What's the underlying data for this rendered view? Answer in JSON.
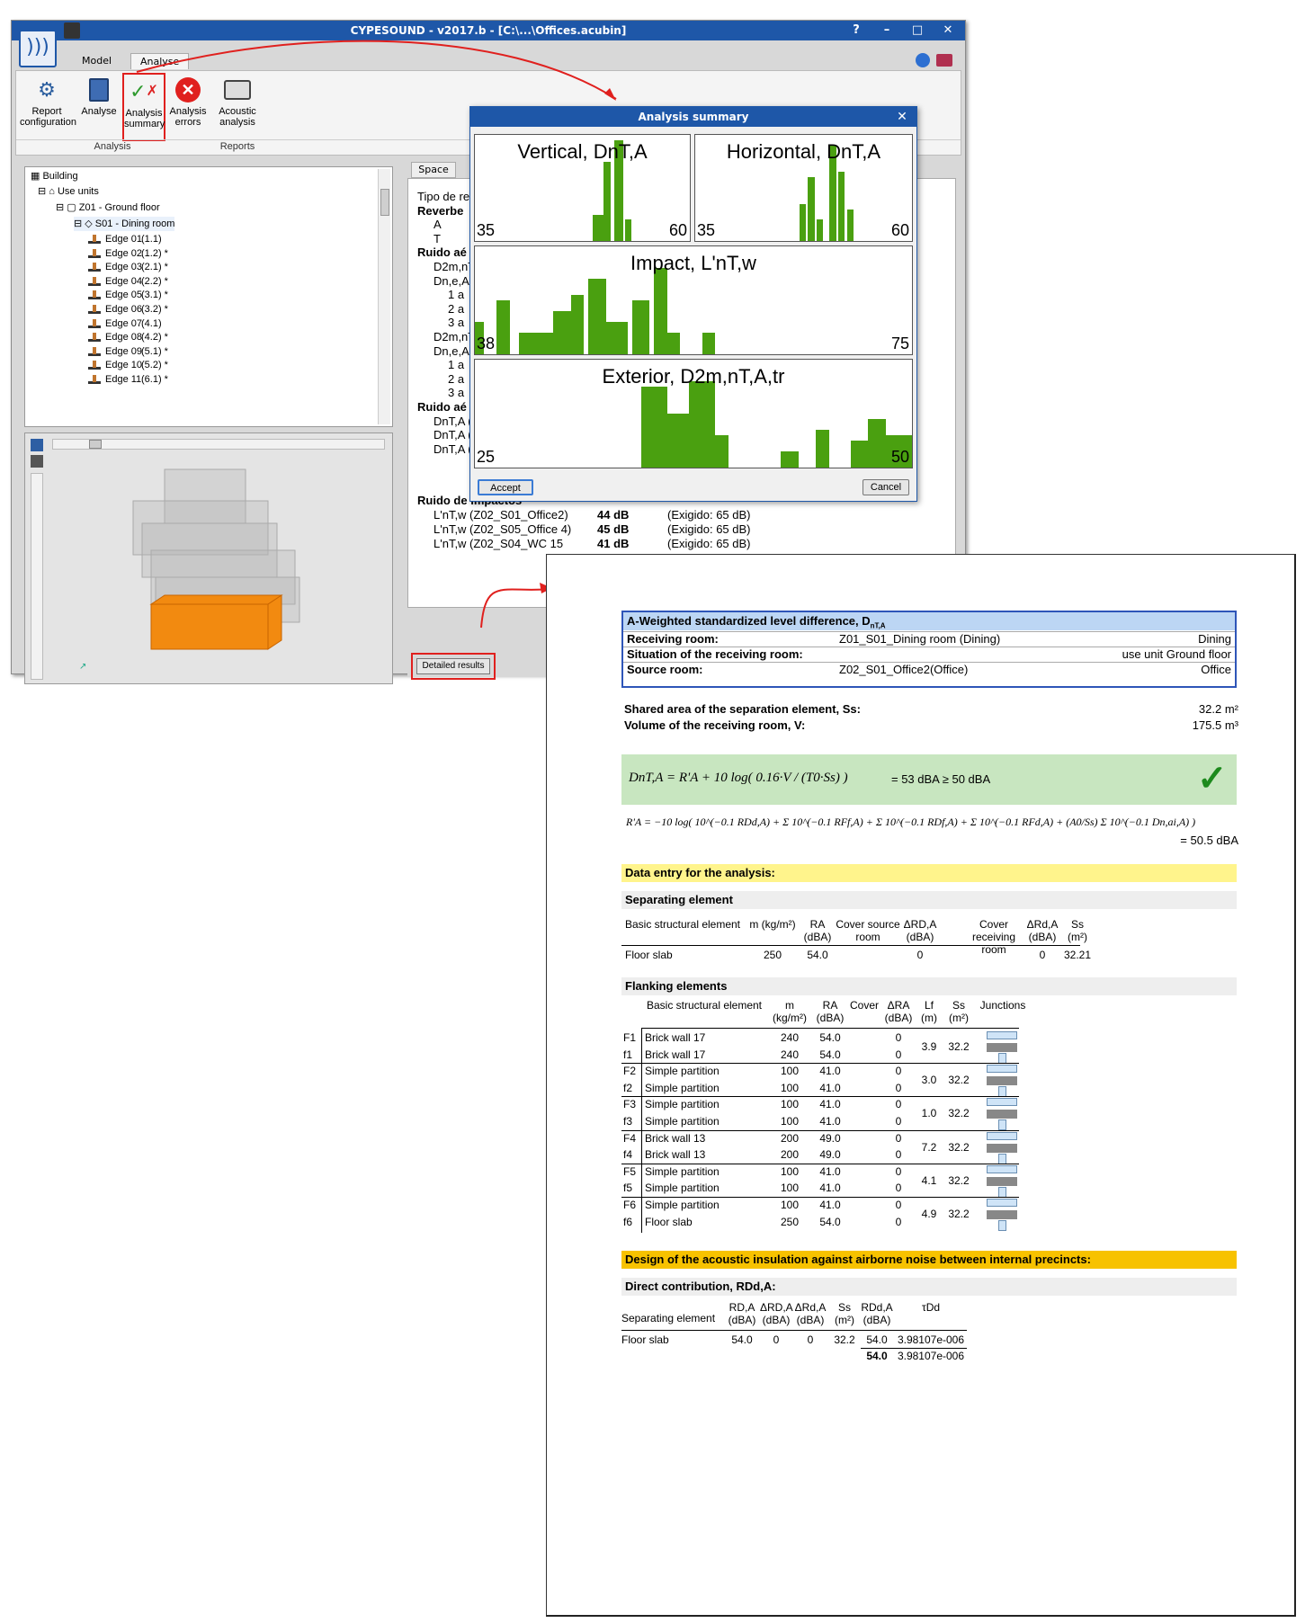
{
  "app": {
    "title": "CYPESOUND - v2017.b - [C:\\...\\Offices.acubin]",
    "help": "?",
    "min": "–",
    "max": "□",
    "close": "✕",
    "tabs": [
      "Model",
      "Analyse"
    ],
    "ribbon": {
      "buttons": [
        {
          "icon": "gear-icon",
          "label1": "Report",
          "label2": "configuration"
        },
        {
          "icon": "calculator-icon",
          "label1": "Analyse",
          "label2": ""
        },
        {
          "icon": "check-cross-icon",
          "label1": "Analysis",
          "label2": "summary"
        },
        {
          "icon": "error-icon",
          "label1": "Analysis",
          "label2": "errors"
        },
        {
          "icon": "printer-icon",
          "label1": "Acoustic",
          "label2": "analysis"
        }
      ],
      "groups": [
        "Analysis",
        "Reports"
      ]
    }
  },
  "tree": {
    "root": "Building",
    "use_units": "Use units",
    "floor": "Z01 - Ground floor",
    "space": "S01 - Dining room",
    "edges": [
      {
        "name": "Edge 01",
        "code": "(1.1)",
        "mark": ""
      },
      {
        "name": "Edge 02",
        "code": "(1.2)",
        "mark": "*"
      },
      {
        "name": "Edge 03",
        "code": "(2.1)",
        "mark": "*"
      },
      {
        "name": "Edge 04",
        "code": "(2.2)",
        "mark": "*"
      },
      {
        "name": "Edge 05",
        "code": "(3.1)",
        "mark": "*"
      },
      {
        "name": "Edge 06",
        "code": "(3.2)",
        "mark": "*"
      },
      {
        "name": "Edge 07",
        "code": "(4.1)",
        "mark": ""
      },
      {
        "name": "Edge 08",
        "code": "(4.2)",
        "mark": "*"
      },
      {
        "name": "Edge 09",
        "code": "(5.1)",
        "mark": "*"
      },
      {
        "name": "Edge 10",
        "code": "(5.2)",
        "mark": "*"
      },
      {
        "name": "Edge 11",
        "code": "(6.1)",
        "mark": "*"
      }
    ]
  },
  "space_panel": {
    "tab": "Space",
    "lines": [
      "Tipo de re",
      "Reverbe",
      "A",
      "T",
      "Ruido aé",
      "D2m,nT,",
      "Dn,e,A,t",
      "1 a",
      "2 a",
      "3 a",
      "D2m,nT,",
      "Dn,e,A,t",
      "1 a",
      "2 a",
      "3 a",
      "Ruido aé",
      "DnT,A (",
      "DnT,A (",
      "DnT,A ("
    ],
    "impact_title": "Ruido de impactos",
    "impact_rows": [
      {
        "label": "L'nT,w (Z02_S01_Office2)",
        "value": "44 dB",
        "req": "(Exigido: 65 dB)"
      },
      {
        "label": "L'nT,w (Z02_S05_Office 4)",
        "value": "45 dB",
        "req": "(Exigido: 65 dB)"
      },
      {
        "label": "L'nT,w (Z02_S04_WC 15",
        "value": "41 dB",
        "req": "(Exigido: 65 dB)"
      }
    ],
    "detailed_button": "Detailed results"
  },
  "dialog": {
    "title": "Analysis summary",
    "close": "✕",
    "accept": "Accept",
    "cancel": "Cancel",
    "charts": [
      {
        "title": "Vertical, DnT,A",
        "min": "35",
        "max": "60"
      },
      {
        "title": "Horizontal, DnT,A",
        "min": "35",
        "max": "60"
      },
      {
        "title": "Impact, L'nT,w",
        "min": "38",
        "max": "75"
      },
      {
        "title": "Exterior, D2m,nT,A,tr",
        "min": "25",
        "max": "50"
      }
    ]
  },
  "report": {
    "header_title": "A-Weighted standardized level difference, D",
    "header_sub": "nT,A",
    "rows": [
      {
        "label": "Receiving room:",
        "mid": "Z01_S01_Dining room (Dining)",
        "right": "Dining"
      },
      {
        "label": "Situation of the receiving room:",
        "mid": "",
        "right": "use unit Ground floor"
      },
      {
        "label": "Source room:",
        "mid": "Z02_S01_Office2(Office)",
        "right": "Office"
      }
    ],
    "shared_area_label": "Shared area of the separation element, Ss:",
    "shared_area_value": "32.2 m²",
    "volume_label": "Volume of the receiving room, V:",
    "volume_value": "175.5 m³",
    "formula1": "DnT,A = R'A + 10 log( 0.16·V / (T0·Ss) )",
    "formula1_result": "= 53 dBA ≥ 50 dBA",
    "formula2": "R'A = −10 log( 10^(−0.1 RDd,A) + Σ 10^(−0.1 RFf,A) + Σ 10^(−0.1 RDf,A) + Σ 10^(−0.1 RFd,A) + (A0/Ss) Σ 10^(−0.1 Dn,ai,A) )",
    "formula2_result": "= 50.5 dBA",
    "data_entry": "Data entry for the analysis:",
    "separating_title": "Separating element",
    "sep_headers": [
      "Basic structural element",
      "m (kg/m²)",
      "RA (dBA)",
      "Cover source room",
      "ΔRD,A (dBA)",
      "Cover receiving room",
      "ΔRd,A (dBA)",
      "Ss (m²)"
    ],
    "sep_row": [
      "Floor slab",
      "250",
      "54.0",
      "",
      "0",
      "",
      "0",
      "32.21"
    ],
    "flanking_title": "Flanking elements",
    "flank_headers": [
      "Basic structural element",
      "m (kg/m²)",
      "RA (dBA)",
      "Cover",
      "ΔRA (dBA)",
      "Lf (m)",
      "Ss (m²)",
      "Junctions"
    ],
    "flank_rows": [
      {
        "code": "F1",
        "name": "Brick wall 17",
        "m": "240",
        "r": "54.0",
        "d": "0"
      },
      {
        "code": "f1",
        "name": "Brick wall 17",
        "m": "240",
        "r": "54.0",
        "d": "0"
      },
      {
        "code": "F2",
        "name": "Simple partition",
        "m": "100",
        "r": "41.0",
        "d": "0"
      },
      {
        "code": "f2",
        "name": "Simple partition",
        "m": "100",
        "r": "41.0",
        "d": "0"
      },
      {
        "code": "F3",
        "name": "Simple partition",
        "m": "100",
        "r": "41.0",
        "d": "0"
      },
      {
        "code": "f3",
        "name": "Simple partition",
        "m": "100",
        "r": "41.0",
        "d": "0"
      },
      {
        "code": "F4",
        "name": "Brick wall 13",
        "m": "200",
        "r": "49.0",
        "d": "0"
      },
      {
        "code": "f4",
        "name": "Brick wall 13",
        "m": "200",
        "r": "49.0",
        "d": "0"
      },
      {
        "code": "F5",
        "name": "Simple partition",
        "m": "100",
        "r": "41.0",
        "d": "0"
      },
      {
        "code": "f5",
        "name": "Simple partition",
        "m": "100",
        "r": "41.0",
        "d": "0"
      },
      {
        "code": "F6",
        "name": "Simple partition",
        "m": "100",
        "r": "41.0",
        "d": "0"
      },
      {
        "code": "f6",
        "name": "Floor slab",
        "m": "250",
        "r": "54.0",
        "d": "0"
      }
    ],
    "flank_pairs": [
      {
        "lf": "3.9",
        "ss": "32.2"
      },
      {
        "lf": "3.0",
        "ss": "32.2"
      },
      {
        "lf": "1.0",
        "ss": "32.2"
      },
      {
        "lf": "7.2",
        "ss": "32.2"
      },
      {
        "lf": "4.1",
        "ss": "32.2"
      },
      {
        "lf": "4.9",
        "ss": "32.2"
      }
    ],
    "design_title": "Design of the acoustic insulation against airborne noise between internal precincts:",
    "direct_title": "Direct contribution, RDd,A:",
    "direct_headers": [
      "Separating element",
      "RD,A (dBA)",
      "ΔRD,A (dBA)",
      "ΔRd,A (dBA)",
      "Ss (m²)",
      "RDd,A (dBA)",
      "τDd"
    ],
    "direct_row": [
      "Floor slab",
      "54.0",
      "0",
      "0",
      "32.2",
      "54.0",
      "3.98107e-006"
    ],
    "direct_total": [
      "54.0",
      "3.98107e-006"
    ]
  },
  "colors": {
    "titlebar": "#1e57a8",
    "bars": "#4aa010",
    "highlight": "#e0201e",
    "formula_bg": "#c8e6c0",
    "section_yellow": "#fff48c",
    "section_orange": "#f7c200",
    "header_blue": "#bcd6f4"
  }
}
